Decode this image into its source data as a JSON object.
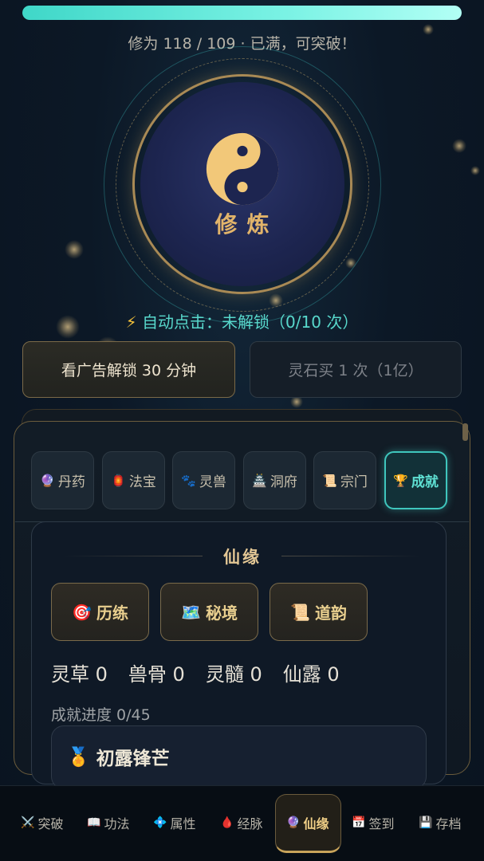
{
  "cultivation": {
    "progress_fraction": 1.0,
    "status": "修为 118 / 109 · 已满，可突破！",
    "button_label": "修炼"
  },
  "auto_click": {
    "icon": "lightning-icon",
    "text": "自动点击：未解锁（0/10 次）"
  },
  "unlock_buttons": {
    "ad_label": "看广告解锁 30 分钟",
    "stone_label": "灵石买 1 次（1亿）"
  },
  "tabs": [
    {
      "icon": "crystal-ball-icon",
      "glyph": "🔮",
      "label": "丹药",
      "active": false
    },
    {
      "icon": "lantern-icon",
      "glyph": "🏮",
      "label": "法宝",
      "active": false
    },
    {
      "icon": "paw-icon",
      "glyph": "🐾",
      "label": "灵兽",
      "active": false
    },
    {
      "icon": "castle-icon",
      "glyph": "🏯",
      "label": "洞府",
      "active": false
    },
    {
      "icon": "scroll-icon",
      "glyph": "📜",
      "label": "宗门",
      "active": false
    },
    {
      "icon": "trophy-icon",
      "glyph": "🏆",
      "label": "成就",
      "active": true
    }
  ],
  "section": {
    "title": "仙缘",
    "buttons": [
      {
        "icon": "target-icon",
        "glyph": "🎯",
        "label": "历练"
      },
      {
        "icon": "map-icon",
        "glyph": "🗺️",
        "label": "秘境"
      },
      {
        "icon": "scroll-icon",
        "glyph": "📜",
        "label": "道韵"
      }
    ],
    "resources": [
      "灵草 0",
      "兽骨 0",
      "灵髓 0",
      "仙露 0"
    ],
    "progress_text": "成就进度 0/45",
    "achievement": {
      "icon": "medal-icon",
      "glyph": "🏅",
      "title": "初露锋芒"
    }
  },
  "nav": [
    {
      "icon": "crossed-swords-icon",
      "glyph": "⚔️",
      "label": "突破",
      "active": false
    },
    {
      "icon": "book-icon",
      "glyph": "📖",
      "label": "功法",
      "active": false
    },
    {
      "icon": "diamond-icon",
      "glyph": "💠",
      "label": "属性",
      "active": false
    },
    {
      "icon": "drop-icon",
      "glyph": "🩸",
      "label": "经脉",
      "active": false
    },
    {
      "icon": "crystal-ball-icon",
      "glyph": "🔮",
      "label": "仙缘",
      "active": true
    },
    {
      "icon": "calendar-icon",
      "glyph": "📅",
      "label": "签到",
      "active": false
    },
    {
      "icon": "floppy-disk-icon",
      "glyph": "💾",
      "label": "存档",
      "active": false
    }
  ],
  "colors": {
    "accent_teal": "#3fc6bd",
    "accent_gold": "#e2b46a"
  }
}
